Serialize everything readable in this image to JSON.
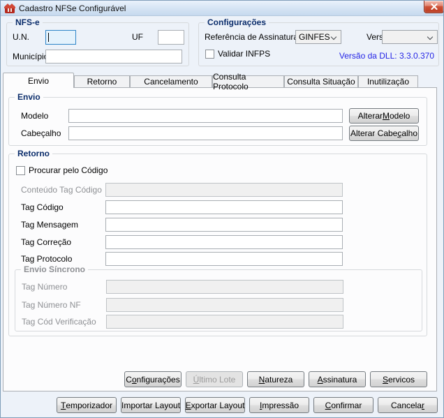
{
  "window": {
    "title": "Cadastro NFSe Configurável"
  },
  "colors": {
    "form_background": "#EDF2F9",
    "group_caption": "#0B2D6B",
    "focus_border": "#2D84C8",
    "focus_fill": "#E4F2FC",
    "close_button_red": "#BA3B21",
    "dll_text_blue": "#2525E6",
    "disabled_text": "#8E9094"
  },
  "nfse": {
    "title": "NFS-e",
    "un_label": "U.N.",
    "un_value": "",
    "uf_label": "UF",
    "uf_value": "",
    "municipio_label": "Município",
    "municipio_value": ""
  },
  "config": {
    "title": "Configurações",
    "ref_label": "Referência de Assinatura",
    "ref_value": "GINFES",
    "versao_label": "Versão",
    "versao_value": "",
    "validar_label": "Validar INFPS",
    "validar_checked": false,
    "dll_text": "Versão da DLL: 3.3.0.370"
  },
  "tabs": [
    {
      "label": "Envio",
      "active": true
    },
    {
      "label": "Retorno",
      "active": false
    },
    {
      "label": "Cancelamento",
      "active": false
    },
    {
      "label": "Consulta Protocolo",
      "active": false
    },
    {
      "label": "Consulta Situação",
      "active": false
    },
    {
      "label": "Inutilização",
      "active": false
    }
  ],
  "envio": {
    "title": "Envio",
    "modelo_label": "Modelo",
    "modelo_value": "",
    "cabecalho_label": "Cabeçalho",
    "cabecalho_value": "",
    "alterar_modelo_label": "Alterar &Modelo",
    "alterar_cabecalho_label": "Alterar Cabe&çalho"
  },
  "retorno": {
    "title": "Retorno",
    "procurar_label": "Procurar pelo Código",
    "procurar_checked": false,
    "conteudo_label": "Conteúdo Tag Código",
    "conteudo_value": "",
    "tag_codigo_label": "Tag Código",
    "tag_codigo_value": "",
    "tag_mensagem_label": "Tag Mensagem",
    "tag_mensagem_value": "",
    "tag_correcao_label": "Tag Correção",
    "tag_correcao_value": "",
    "tag_protocolo_label": "Tag Protocolo",
    "tag_protocolo_value": "",
    "sincrono": {
      "title": "Envio Síncrono",
      "tag_numero_label": "Tag Número",
      "tag_numero_value": "",
      "tag_numero_nf_label": "Tag Número NF",
      "tag_numero_nf_value": "",
      "tag_cod_verificacao_label": "Tag Cód Verificação",
      "tag_cod_verificacao_value": ""
    }
  },
  "buttons_row1": [
    {
      "label": "C&onfigurações",
      "disabled": false
    },
    {
      "label": "&Último Lote",
      "disabled": true
    },
    {
      "label": "&Natureza",
      "disabled": false
    },
    {
      "label": "&Assinatura",
      "disabled": false
    },
    {
      "label": "&Servicos",
      "disabled": false
    }
  ],
  "buttons_row2": [
    {
      "label": "&Temporizador"
    },
    {
      "label": "Importar Layout"
    },
    {
      "label": "&Exportar Layout"
    },
    {
      "label": "&Impressão"
    },
    {
      "label": "&Confirmar"
    },
    {
      "label": "Cancela&r"
    }
  ]
}
